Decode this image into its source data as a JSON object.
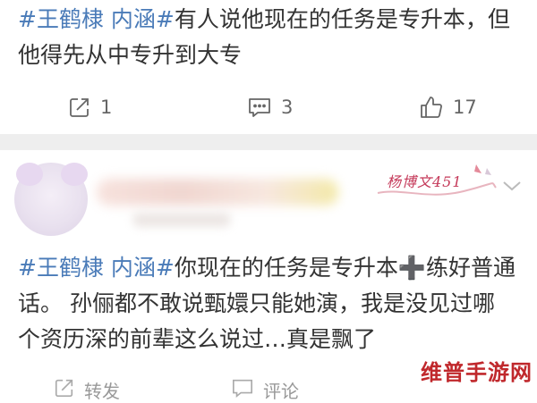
{
  "post1": {
    "tag": "#王鹤棣 内涵#",
    "text_line1": "有人说他现在的任务是专升本，但",
    "text_line2": "他得先从中专升到大专",
    "actions": {
      "repost_count": "1",
      "comment_count": "3",
      "like_count": "17"
    }
  },
  "post2": {
    "user_badge": "杨博文451",
    "tag": "#王鹤棣 内涵#",
    "text_part1": "你现在的任务是专升本",
    "plus_glyph": "➕",
    "text_part2": "练好普通",
    "text_line2": "话。 孙俪都不敢说甄嬛只能她演，我是没见过哪",
    "text_line3": "个资历深的前辈这么说过…真是飘了",
    "actions": {
      "repost_label": "转发",
      "comment_label": "评论"
    }
  },
  "watermark": "维普手游网",
  "icons": {
    "repost": "repost-icon",
    "comment": "comment-icon",
    "like": "thumbs-up-icon",
    "more": "chevron-down-icon"
  },
  "colors": {
    "tag": "#4a7bb8",
    "watermark": "#c0282c",
    "divider": "#eeeeee"
  }
}
